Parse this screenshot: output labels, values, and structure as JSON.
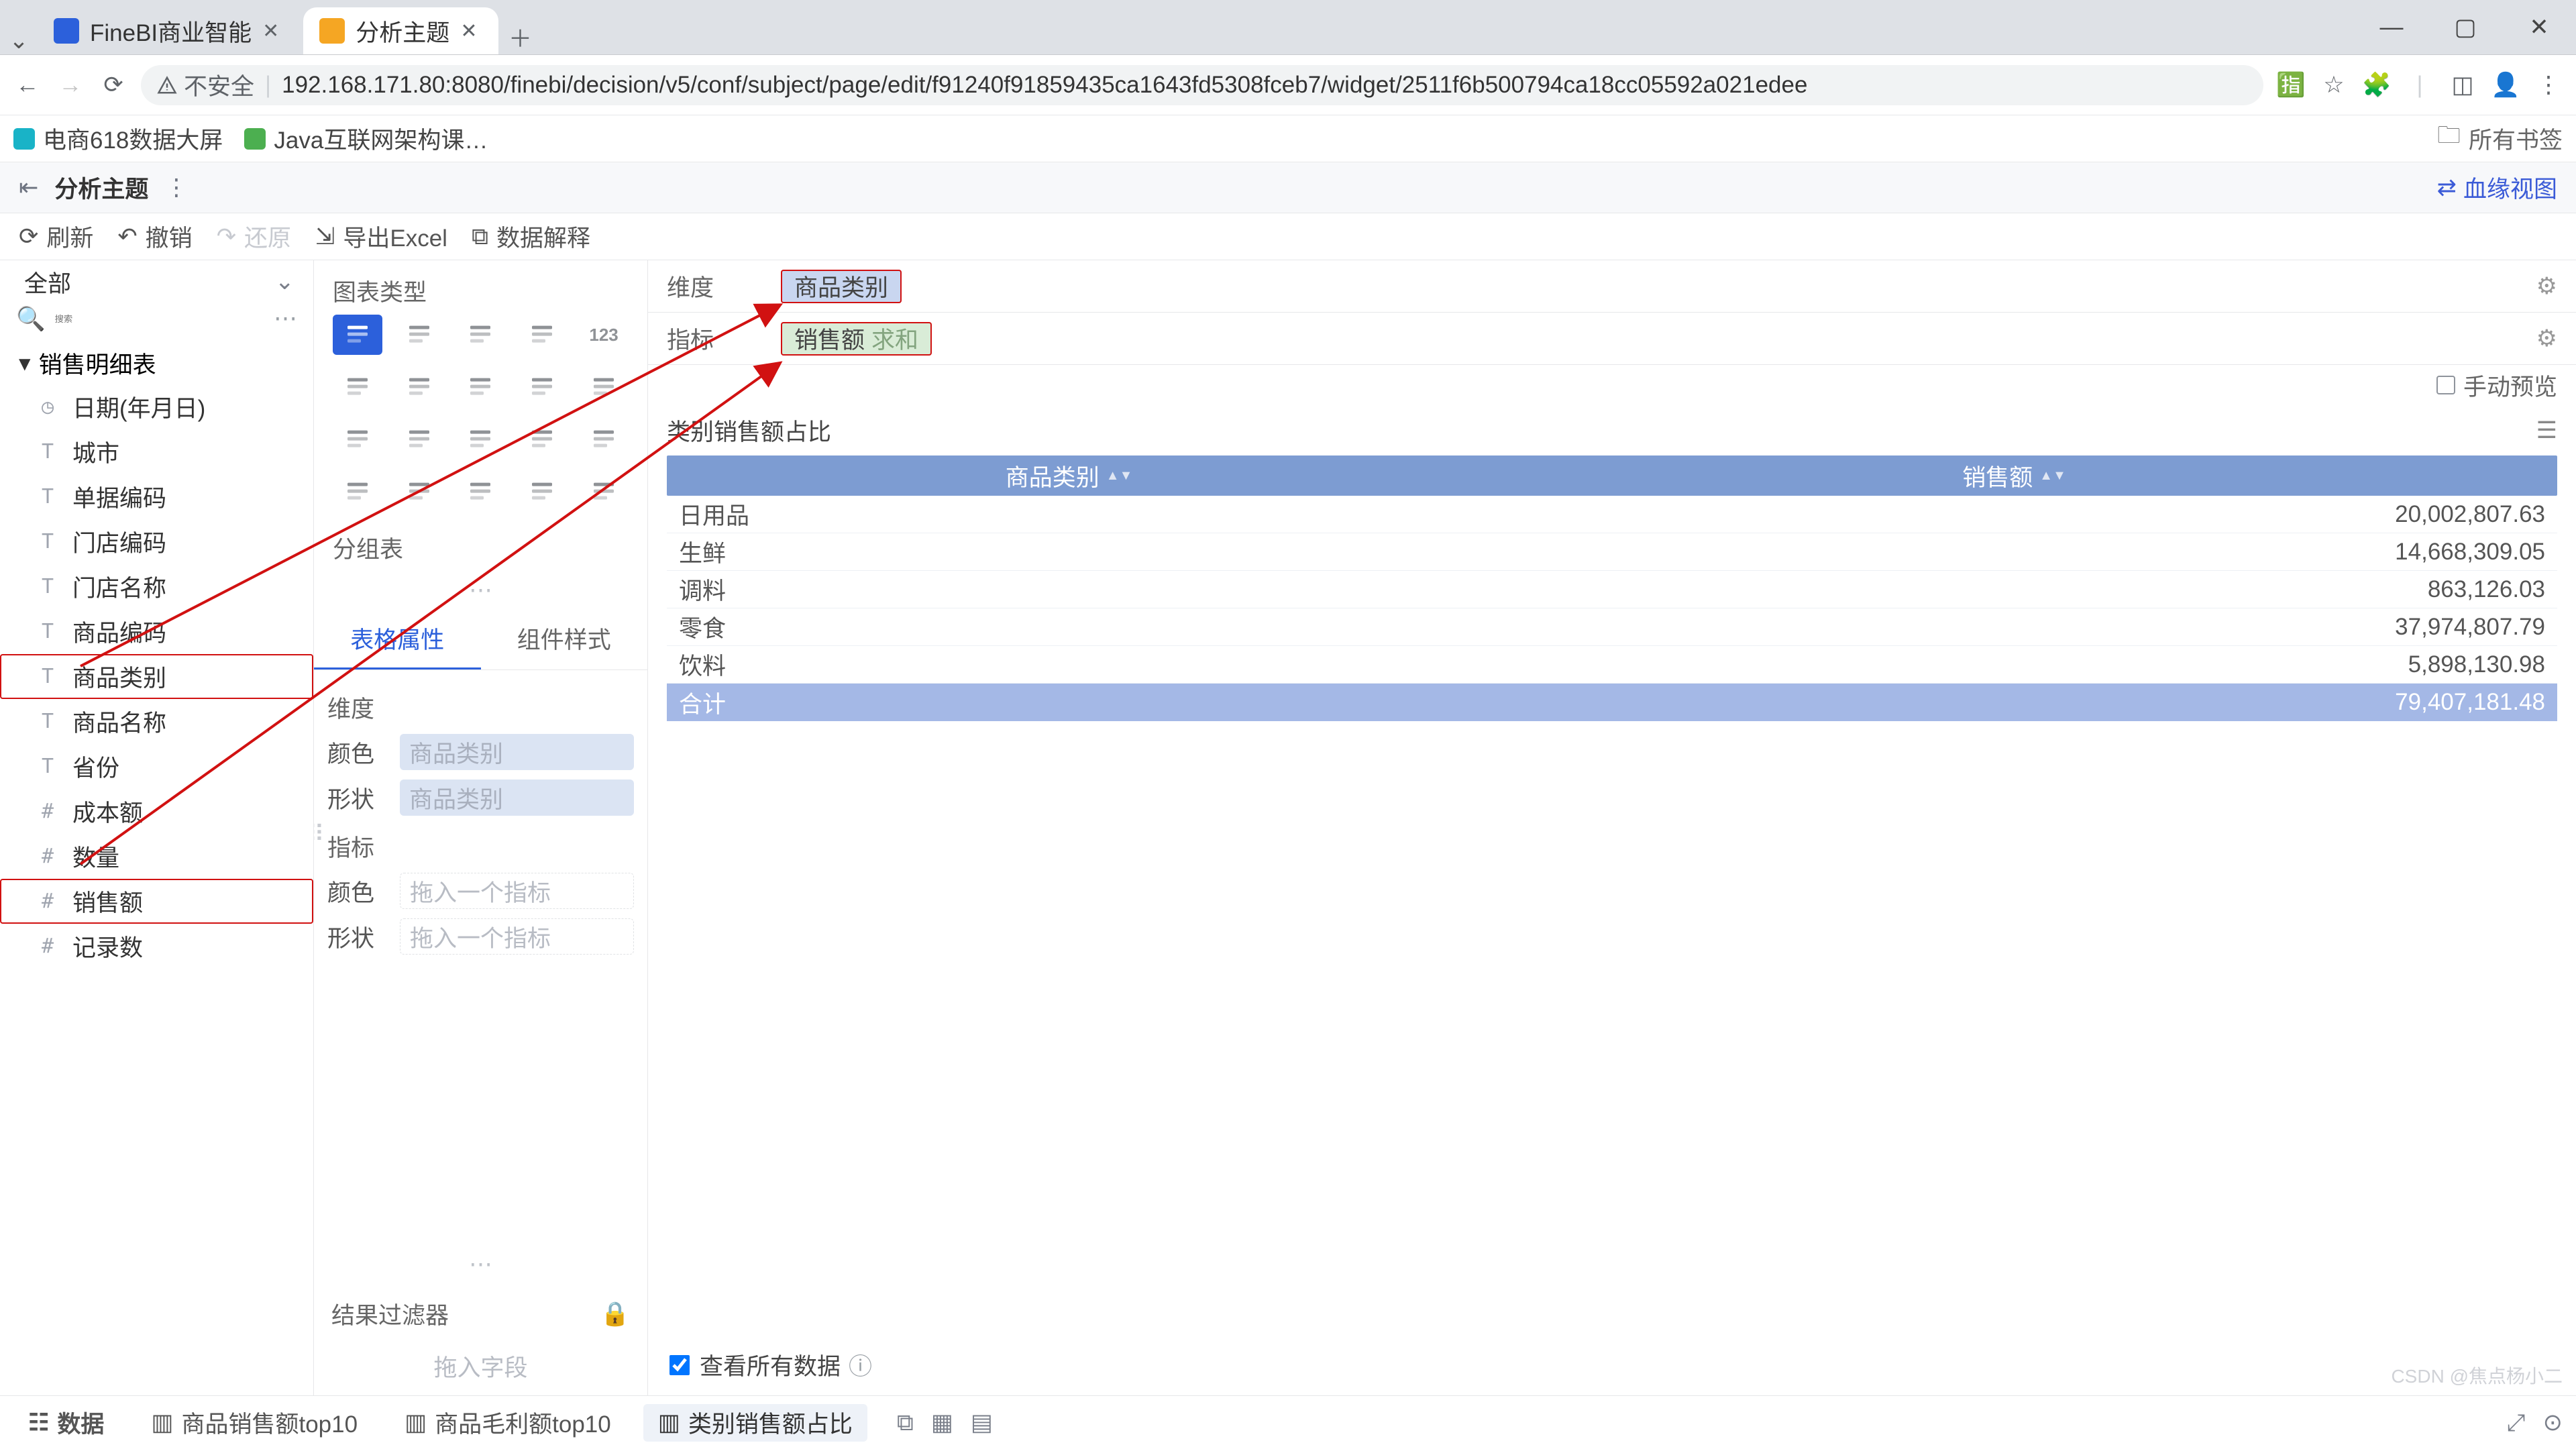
{
  "browser": {
    "tabs": [
      {
        "title": "FineBI商业智能",
        "active": false
      },
      {
        "title": "分析主题",
        "active": true
      }
    ],
    "insecure_label": "不安全",
    "url": "192.168.171.80:8080/finebi/decision/v5/conf/subject/page/edit/f91240f91859435ca1643fd5308fceb7/widget/2511f6b500794ca18cc05592a021edee",
    "bookmarks": [
      {
        "name": "电商618数据大屏",
        "color": "#19b3c7"
      },
      {
        "name": "Java互联网架构课…",
        "color": "#4caf50"
      }
    ],
    "all_bookmarks": "所有书签"
  },
  "finebi": {
    "title": "分析主题",
    "blood": "血缘视图",
    "toolbar": {
      "refresh": "刷新",
      "undo": "撤销",
      "redo": "还原",
      "excel": "导出Excel",
      "explain": "数据解释"
    }
  },
  "fields": {
    "all": "全部",
    "search_placeholder": "搜索",
    "table_name": "销售明细表",
    "items": [
      {
        "icon": "clock",
        "name": "日期(年月日)"
      },
      {
        "icon": "T",
        "name": "城市"
      },
      {
        "icon": "T",
        "name": "单据编码"
      },
      {
        "icon": "T",
        "name": "门店编码"
      },
      {
        "icon": "T",
        "name": "门店名称"
      },
      {
        "icon": "T",
        "name": "商品编码"
      },
      {
        "icon": "T",
        "name": "商品类别",
        "hl": true
      },
      {
        "icon": "T",
        "name": "商品名称"
      },
      {
        "icon": "T",
        "name": "省份"
      },
      {
        "icon": "#",
        "name": "成本额"
      },
      {
        "icon": "#",
        "name": "数量"
      },
      {
        "icon": "#",
        "name": "销售额",
        "hl": true
      },
      {
        "icon": "#",
        "name": "记录数"
      }
    ]
  },
  "types": {
    "section": "图表类型",
    "group_table": "分组表",
    "tabs": {
      "attr": "表格属性",
      "style": "组件样式"
    },
    "dim_label": "维度",
    "metric_label": "指标",
    "color": "颜色",
    "shape": "形状",
    "dim_placeholder": "商品类别",
    "metric_placeholder": "拖入一个指标",
    "result_filter": "结果过滤器",
    "drop_field": "拖入字段"
  },
  "canvas": {
    "dim_label": "维度",
    "metric_label": "指标",
    "dim_pill": "商品类别",
    "metric_pill": "销售额",
    "metric_sub": "求和",
    "manual_preview": "手动预览",
    "chart_title": "类别销售额占比",
    "columns": {
      "c1": "商品类别",
      "c2": "销售额"
    },
    "rows": [
      {
        "cat": "日用品",
        "val": "20,002,807.63"
      },
      {
        "cat": "生鲜",
        "val": "14,668,309.05"
      },
      {
        "cat": "调料",
        "val": "863,126.03"
      },
      {
        "cat": "零食",
        "val": "37,974,807.79"
      },
      {
        "cat": "饮料",
        "val": "5,898,130.98"
      }
    ],
    "total_label": "合计",
    "total_value": "79,407,181.48",
    "view_all": "查看所有数据"
  },
  "bottom": {
    "data": "数据",
    "tabs": [
      {
        "name": "商品销售额top10"
      },
      {
        "name": "商品毛利额top10"
      },
      {
        "name": "类别销售额占比",
        "sel": true
      }
    ]
  },
  "watermark": "CSDN @焦点杨小二"
}
